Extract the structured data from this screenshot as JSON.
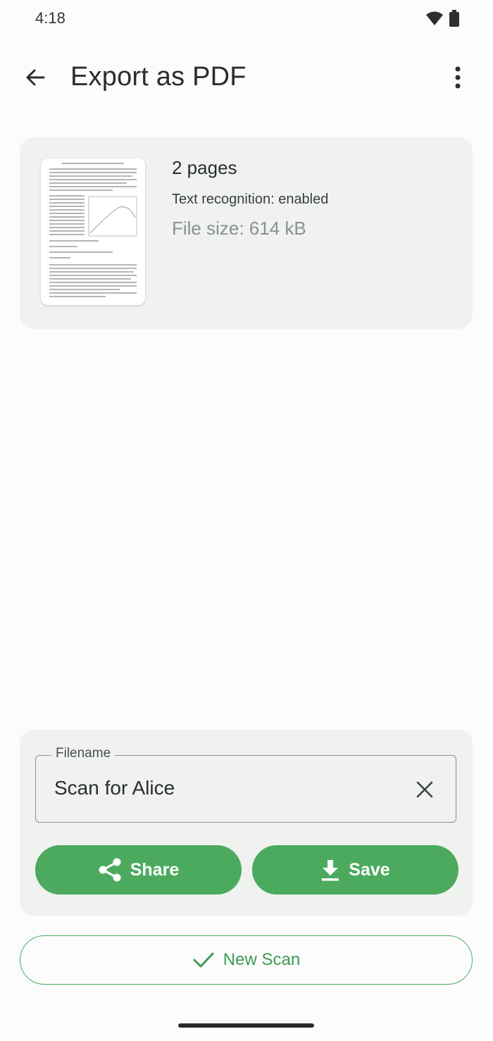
{
  "status": {
    "time": "4:18"
  },
  "app_bar": {
    "title": "Export as PDF"
  },
  "document": {
    "pages": "2 pages",
    "ocr": "Text recognition: enabled",
    "file_size": "File size: 614 kB"
  },
  "filename": {
    "label": "Filename",
    "value": "Scan for Alice"
  },
  "actions": {
    "share": "Share",
    "save": "Save",
    "new_scan": "New Scan"
  },
  "colors": {
    "accent": "#4caa5f",
    "panel": "#eff2ef",
    "background": "#fbfcfb"
  }
}
